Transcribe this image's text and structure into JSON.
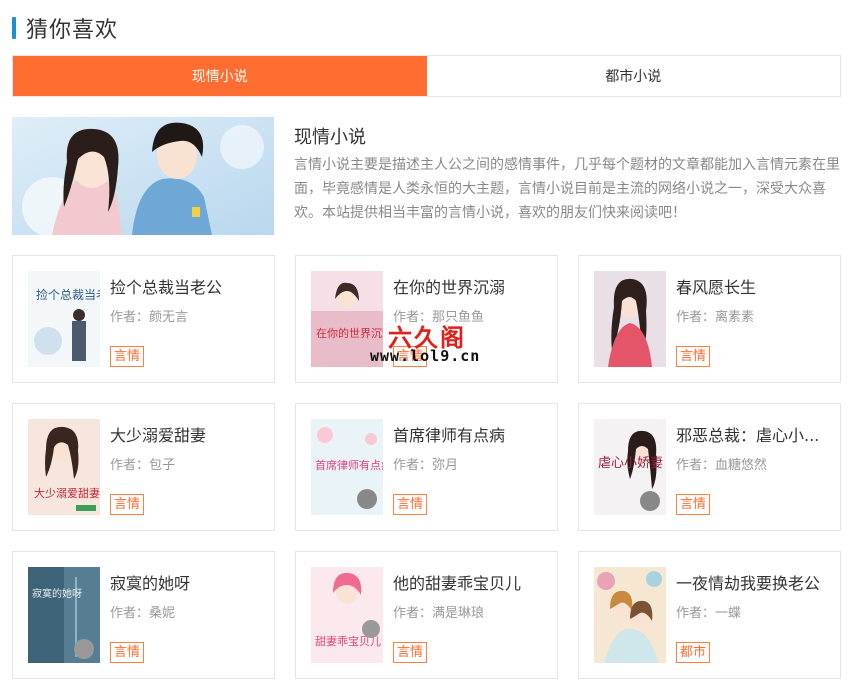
{
  "section": {
    "title": "猜你喜欢"
  },
  "tabs": [
    {
      "label": "现情小说",
      "active": true
    },
    {
      "label": "都市小说",
      "active": false
    }
  ],
  "feature": {
    "name": "现情小说",
    "description": "言情小说主要是描述主人公之间的感情事件，几乎每个题材的文章都能加入言情元素在里面，毕竟感情是人类永恒的大主题，言情小说目前是主流的网络小说之一，深受大众喜欢。本站提供相当丰富的言情小说，喜欢的朋友们快来阅读吧！"
  },
  "books": [
    {
      "title": "捡个总裁当老公",
      "author": "作者：颜无言",
      "tag": "言情",
      "cover_text": "捡个总裁当老公"
    },
    {
      "title": "在你的世界沉溺",
      "author": "作者：那只鱼鱼",
      "tag": "言情",
      "cover_text": "在你的世界沉溺"
    },
    {
      "title": "春风愿长生",
      "author": "作者：离素素",
      "tag": "言情",
      "cover_text": ""
    },
    {
      "title": "大少溺爱甜妻",
      "author": "作者：包子",
      "tag": "言情",
      "cover_text": "大少溺爱甜妻"
    },
    {
      "title": "首席律师有点病",
      "author": "作者：弥月",
      "tag": "言情",
      "cover_text": "首席律师有点病"
    },
    {
      "title": "邪恶总裁：虐心小...",
      "author": "作者：血糖悠然",
      "tag": "言情",
      "cover_text": "虐心小娇妻"
    },
    {
      "title": "寂寞的她呀",
      "author": "作者：桑妮",
      "tag": "言情",
      "cover_text": "寂寞的她呀"
    },
    {
      "title": "他的甜妻乖宝贝儿",
      "author": "作者：满是琳琅",
      "tag": "言情",
      "cover_text": "甜妻乖宝贝儿"
    },
    {
      "title": "一夜情劫我要换老公",
      "author": "作者：一蝶",
      "tag": "都市",
      "cover_text": ""
    }
  ],
  "watermark": {
    "logo": "六久阁",
    "url": "www.lol9.cn"
  }
}
